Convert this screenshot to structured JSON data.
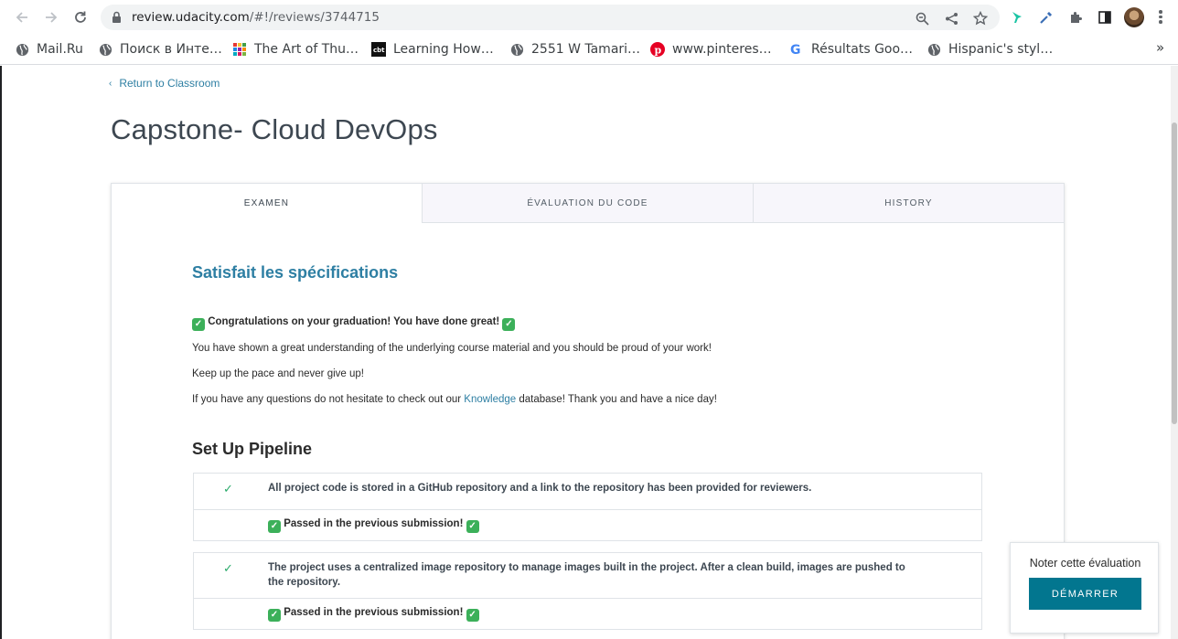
{
  "browser": {
    "url_host": "review.udacity.com",
    "url_path": "/#!/reviews/3744715",
    "bookmarks": [
      {
        "label": "Mail.Ru",
        "icon": "globe-icon"
      },
      {
        "label": "Поиск в Инте…",
        "icon": "globe-icon"
      },
      {
        "label": "The Art of Thu…",
        "icon": "grid-icon"
      },
      {
        "label": "Learning How…",
        "icon": "cbt-icon"
      },
      {
        "label": "2551 W Tamari…",
        "icon": "globe-icon"
      },
      {
        "label": "www.pinteres…",
        "icon": "pinterest-icon"
      },
      {
        "label": "Résultats Goo…",
        "icon": "google-icon"
      },
      {
        "label": "Hispanic's styl…",
        "icon": "globe-icon"
      }
    ],
    "more_bookmarks": "»"
  },
  "page": {
    "return_link": "Return to Classroom",
    "title": "Capstone- Cloud DevOps",
    "tabs": [
      {
        "label": "EXAMEN",
        "active": true
      },
      {
        "label": "ÉVALUATION DU CODE",
        "active": false
      },
      {
        "label": "HISTORY",
        "active": false
      }
    ],
    "result_title": "Satisfait les spécifications",
    "summary": {
      "congrats": "Congratulations on your graduation! You have done great!",
      "line1": "You have shown a great understanding of the underlying course material and you should be proud of your work!",
      "line2": "Keep up the pace and never give up!",
      "line3_before": "If you have any questions do not hesitate to check out our ",
      "line3_link": "Knowledge",
      "line3_after": " database! Thank you and have a nice day!"
    },
    "section_title": "Set Up Pipeline",
    "criteria": [
      {
        "text": "All project code is stored in a GitHub repository and a link to the repository has been provided for reviewers.",
        "feedback": "Passed in the previous submission!"
      },
      {
        "text": "The project uses a centralized image repository to manage images built in the project. After a clean build, images are pushed to the repository.",
        "feedback": "Passed in the previous submission!"
      }
    ]
  },
  "rate": {
    "label": "Noter cette évaluation",
    "button": "DÉMARRER"
  },
  "colors": {
    "accent": "#2e7fa3",
    "button": "#02768f",
    "check": "#2aaa6a",
    "emoji_check": "#3cb05a"
  }
}
